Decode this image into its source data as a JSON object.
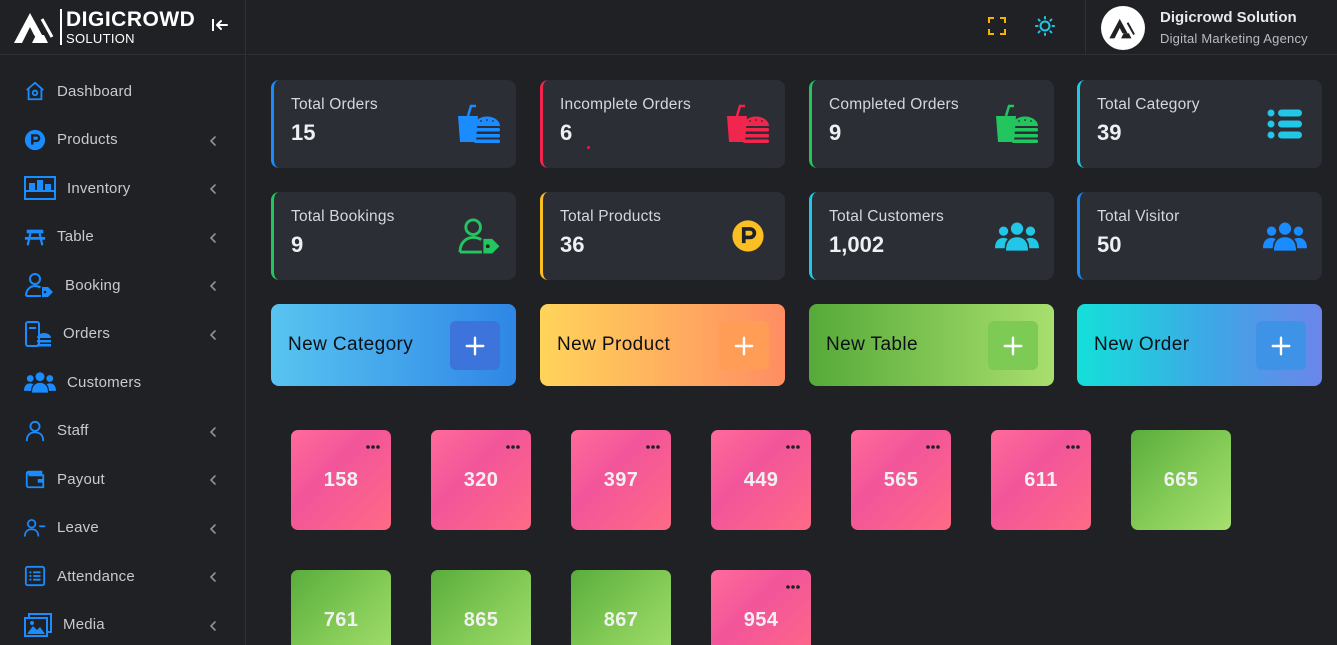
{
  "brand": {
    "name": "DIGICROWD",
    "sub": "SOLUTION"
  },
  "sidebar": {
    "items": [
      {
        "label": "Dashboard",
        "icon": "home-icon",
        "chevron": false
      },
      {
        "label": "Products",
        "icon": "product-p-icon",
        "chevron": true
      },
      {
        "label": "Inventory",
        "icon": "inventory-icon",
        "chevron": true
      },
      {
        "label": "Table",
        "icon": "picnic-table-icon",
        "chevron": true
      },
      {
        "label": "Booking",
        "icon": "user-tag-icon",
        "chevron": true
      },
      {
        "label": "Orders",
        "icon": "orders-icon",
        "chevron": true
      },
      {
        "label": "Customers",
        "icon": "users-icon",
        "chevron": false
      },
      {
        "label": "Staff",
        "icon": "user-icon",
        "chevron": true
      },
      {
        "label": "Payout",
        "icon": "wallet-icon",
        "chevron": true
      },
      {
        "label": "Leave",
        "icon": "user-minus-icon",
        "chevron": true
      },
      {
        "label": "Attendance",
        "icon": "list-icon",
        "chevron": true
      },
      {
        "label": "Media",
        "icon": "image-icon",
        "chevron": true
      }
    ],
    "accent": "#1a8cff"
  },
  "header": {
    "fullscreen_icon": "fullscreen-icon",
    "theme_icon": "sun-icon",
    "profile": {
      "name": "Digicrowd Solution",
      "role": "Digital Marketing Agency"
    }
  },
  "stats": [
    {
      "title": "Total Orders",
      "value": "15",
      "color": "#1a8cff",
      "icon": "food-drink-icon"
    },
    {
      "title": "Incomplete Orders",
      "value": "6",
      "color": "#f0264d",
      "icon": "food-drink-icon"
    },
    {
      "title": "Completed Orders",
      "value": "9",
      "color": "#22c55e",
      "icon": "food-drink-icon"
    },
    {
      "title": "Total Category",
      "value": "39",
      "color": "#22c6e6",
      "icon": "list-icon"
    },
    {
      "title": "Total Bookings",
      "value": "9",
      "color": "#22c55e",
      "icon": "user-tag-icon"
    },
    {
      "title": "Total Products",
      "value": "36",
      "color": "#fbbf24",
      "icon": "product-p-icon"
    },
    {
      "title": "Total Customers",
      "value": "1,002",
      "color": "#22c6e6",
      "icon": "users-icon"
    },
    {
      "title": "Total Visitor",
      "value": "50",
      "color": "#1a8cff",
      "icon": "users-icon"
    }
  ],
  "actions": [
    {
      "label": "New Category",
      "icon": "plus-icon"
    },
    {
      "label": "New Product",
      "icon": "plus-icon"
    },
    {
      "label": "New Table",
      "icon": "plus-icon"
    },
    {
      "label": "New Order",
      "icon": "plus-icon"
    }
  ],
  "tables": [
    {
      "number": "158",
      "status": "occupied"
    },
    {
      "number": "320",
      "status": "occupied"
    },
    {
      "number": "397",
      "status": "occupied"
    },
    {
      "number": "449",
      "status": "occupied"
    },
    {
      "number": "565",
      "status": "occupied"
    },
    {
      "number": "611",
      "status": "occupied"
    },
    {
      "number": "665",
      "status": "available"
    },
    {
      "number": "761",
      "status": "available"
    },
    {
      "number": "865",
      "status": "available"
    },
    {
      "number": "867",
      "status": "available"
    },
    {
      "number": "954",
      "status": "occupied"
    }
  ],
  "colors": {
    "occupied": "#f5559a",
    "available": "#7cc552",
    "background": "#1f2125",
    "card": "#2b2e34"
  }
}
